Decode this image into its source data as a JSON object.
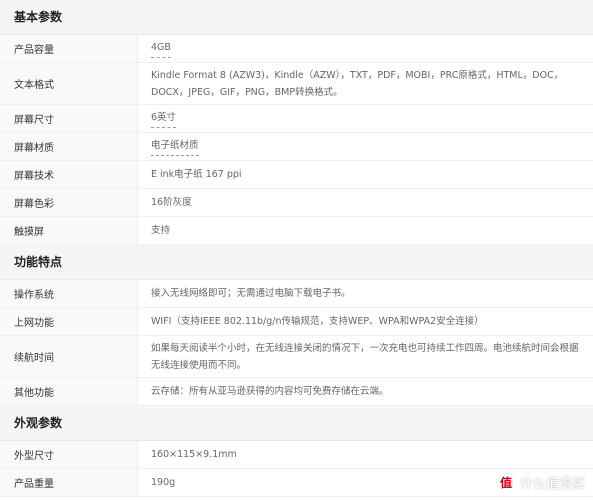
{
  "sections": [
    {
      "title": "基本参数",
      "rows": [
        {
          "label": "产品容量",
          "value": "4GB"
        },
        {
          "label": "文本格式",
          "value": "Kindle Format 8 (AZW3)，Kindle（AZW），TXT，PDF，MOBI，PRC原格式，HTML，DOC，DOCX，JPEG，GIF，PNG，BMP转换格式。"
        },
        {
          "label": "屏幕尺寸",
          "value": "6英寸"
        },
        {
          "label": "屏幕材质",
          "value": "电子纸材质"
        },
        {
          "label": "屏幕技术",
          "value": "E ink电子纸 167 ppi"
        },
        {
          "label": "屏幕色彩",
          "value": "16阶灰度"
        },
        {
          "label": "触摸屏",
          "value": "支持"
        }
      ]
    },
    {
      "title": "功能特点",
      "rows": [
        {
          "label": "操作系统",
          "value": "接入无线网络即可；无需通过电脑下载电子书。"
        },
        {
          "label": "上网功能",
          "value": "WIFI（支持IEEE 802.11b/g/n传输规范，支持WEP、WPA和WPA2安全连接）"
        },
        {
          "label": "续航时间",
          "value": "如果每天阅读半个小时，在无线连接关闭的情况下，一次充电也可持续工作四周。电池续航时间会根据无线连接使用而不同。"
        },
        {
          "label": "其他功能",
          "value": "云存储：所有从亚马逊获得的内容均可免费存储在云端。"
        }
      ]
    },
    {
      "title": "外观参数",
      "rows": [
        {
          "label": "外型尺寸",
          "value": "160×115×9.1mm"
        },
        {
          "label": "产品重量",
          "value": "190g"
        }
      ]
    }
  ],
  "watermark": {
    "icon": "值",
    "text": "什么值得买"
  }
}
